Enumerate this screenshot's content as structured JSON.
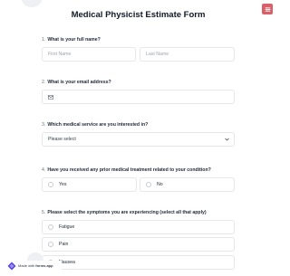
{
  "form": {
    "title": "Medical Physicist Estimate Form"
  },
  "questions": {
    "q1": {
      "num": "1.",
      "label": "What is your full name?",
      "first_placeholder": "First Name",
      "last_placeholder": "Last Name"
    },
    "q2": {
      "num": "2.",
      "label": "What is your email address?"
    },
    "q3": {
      "num": "3.",
      "label": "Which medical service are you interested in?",
      "select_value": "Please select"
    },
    "q4": {
      "num": "4.",
      "label": "Have you received any prior medical treatment related to your condition?",
      "options": [
        "Yes",
        "No"
      ]
    },
    "q5": {
      "num": "5.",
      "label": "Please select the symptoms you are experiencing (select all that apply)",
      "options": [
        "Fatigue",
        "Pain",
        "Nausea"
      ]
    }
  },
  "badge": {
    "made_with": "Made with",
    "brand": "forms.app"
  },
  "colors": {
    "accent": "#d95f6a",
    "border": "#e5e7eb"
  }
}
